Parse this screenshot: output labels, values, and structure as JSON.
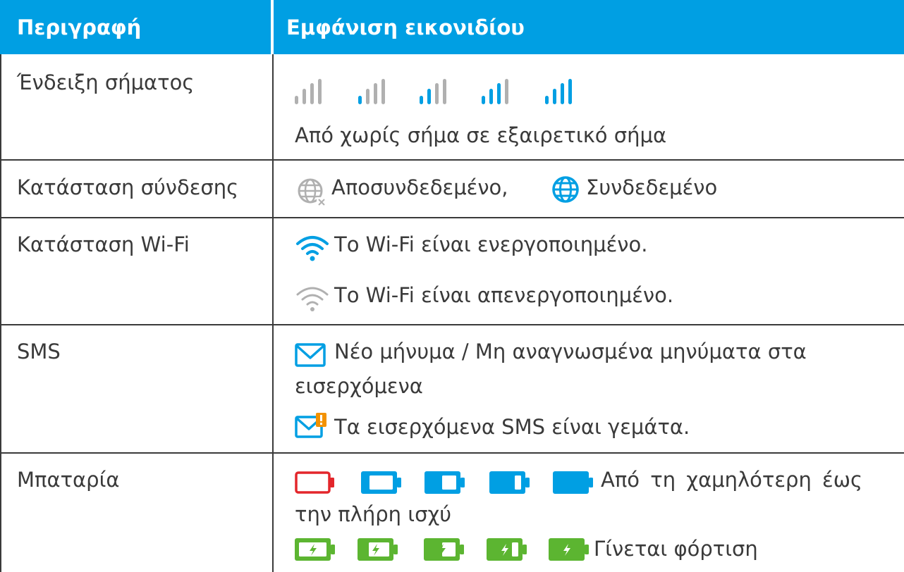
{
  "header": {
    "col_description": "Περιγραφή",
    "col_icon": "Εμφάνιση εικονιδίου"
  },
  "rows": {
    "signal": {
      "label": "Ένδειξη σήματος",
      "text": "Από χωρίς σήμα σε εξαιρετικό σήμα",
      "icons": [
        "signal-0-icon",
        "signal-1-icon",
        "signal-2-icon",
        "signal-3-icon",
        "signal-4-icon"
      ],
      "levels_bars_lit": [
        0,
        1,
        2,
        3,
        4
      ]
    },
    "connection": {
      "label": "Κατάσταση σύνδεσης",
      "disconnected": "Αποσυνδεδεμένο,",
      "connected": "Συνδεδεμένο",
      "icons": [
        "globe-disconnected-icon",
        "globe-connected-icon"
      ]
    },
    "wifi": {
      "label": "Κατάσταση Wi-Fi",
      "on": "Το Wi-Fi είναι ενεργοποιημένο.",
      "off": "Το Wi-Fi είναι απενεργοποιημένο.",
      "icons": [
        "wifi-on-icon",
        "wifi-off-icon"
      ]
    },
    "sms": {
      "label": "SMS",
      "new_line1": "Νέο μήνυμα / Μη αναγνωσμένα μηνύματα στα",
      "new_line2": "εισερχόμενα",
      "full": "Τα εισερχόμενα SMS είναι γεμάτα.",
      "icons": [
        "envelope-icon",
        "envelope-alert-icon"
      ]
    },
    "battery": {
      "label": "Μπαταρία",
      "levels_line1": "Από τη χαμηλότερη έως",
      "levels_line2": "την πλήρη ισχύ",
      "charging": "Γίνεται φόρτιση",
      "icons": [
        "battery-empty-icon",
        "battery-low-icon",
        "battery-half-icon",
        "battery-high-icon",
        "battery-full-icon",
        "battery-charging-icon"
      ]
    }
  },
  "colors": {
    "header": "#009fe3",
    "accent": "#009fe3",
    "muted": "#b0b0b0",
    "battery_low": "#e3262b",
    "battery_charging": "#5cb531",
    "alert": "#f39200"
  }
}
